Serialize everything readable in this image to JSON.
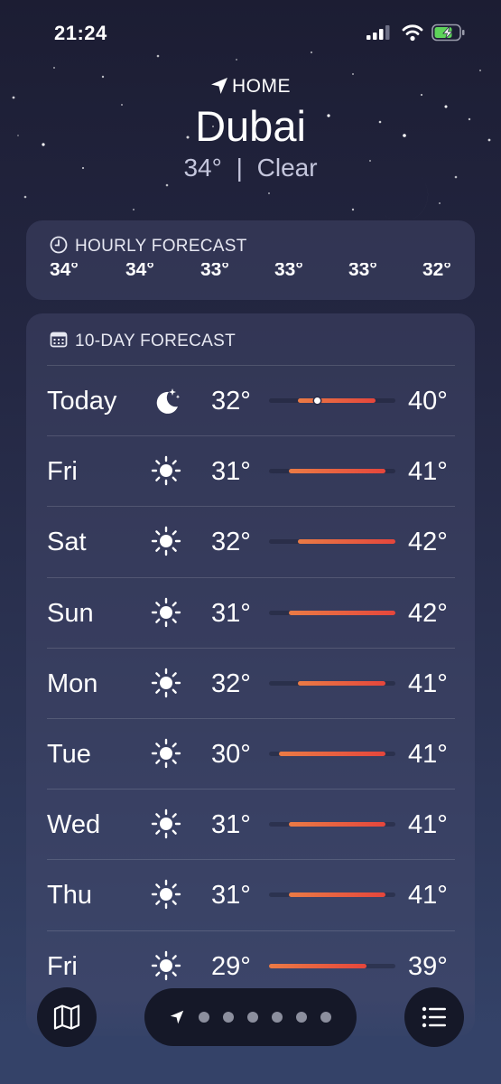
{
  "status_bar": {
    "time": "21:24"
  },
  "header": {
    "home_label": "HOME",
    "city": "Dubai",
    "current_temp": "34°",
    "separator": "|",
    "condition": "Clear"
  },
  "hourly": {
    "title": "HOURLY FORECAST",
    "temps": [
      "34°",
      "34°",
      "33°",
      "33°",
      "33°",
      "32°"
    ]
  },
  "daily": {
    "title": "10-DAY FORECAST",
    "range_min": 29,
    "range_max": 42,
    "days": [
      {
        "day": "Today",
        "icon": "moon-stars-icon",
        "low": "32°",
        "high": "40°",
        "low_value": 32,
        "high_value": 40,
        "current_value": 34
      },
      {
        "day": "Fri",
        "icon": "sun-icon",
        "low": "31°",
        "high": "41°",
        "low_value": 31,
        "high_value": 41
      },
      {
        "day": "Sat",
        "icon": "sun-icon",
        "low": "32°",
        "high": "42°",
        "low_value": 32,
        "high_value": 42
      },
      {
        "day": "Sun",
        "icon": "sun-icon",
        "low": "31°",
        "high": "42°",
        "low_value": 31,
        "high_value": 42
      },
      {
        "day": "Mon",
        "icon": "sun-icon",
        "low": "32°",
        "high": "41°",
        "low_value": 32,
        "high_value": 41
      },
      {
        "day": "Tue",
        "icon": "sun-icon",
        "low": "30°",
        "high": "41°",
        "low_value": 30,
        "high_value": 41
      },
      {
        "day": "Wed",
        "icon": "sun-icon",
        "low": "31°",
        "high": "41°",
        "low_value": 31,
        "high_value": 41
      },
      {
        "day": "Thu",
        "icon": "sun-icon",
        "low": "31°",
        "high": "41°",
        "low_value": 31,
        "high_value": 41
      },
      {
        "day": "Fri",
        "icon": "sun-icon",
        "low": "29°",
        "high": "39°",
        "low_value": 29,
        "high_value": 39
      }
    ]
  },
  "toolbar": {
    "map_icon": "map-icon",
    "list_icon": "list-icon",
    "location_icon": "location-arrow-icon",
    "page_count": 6
  },
  "colors": {
    "bar_start": "#ea7b45",
    "bar_end": "#e5463c",
    "background_top": "#1c1d33",
    "background_bottom": "#35446a"
  }
}
